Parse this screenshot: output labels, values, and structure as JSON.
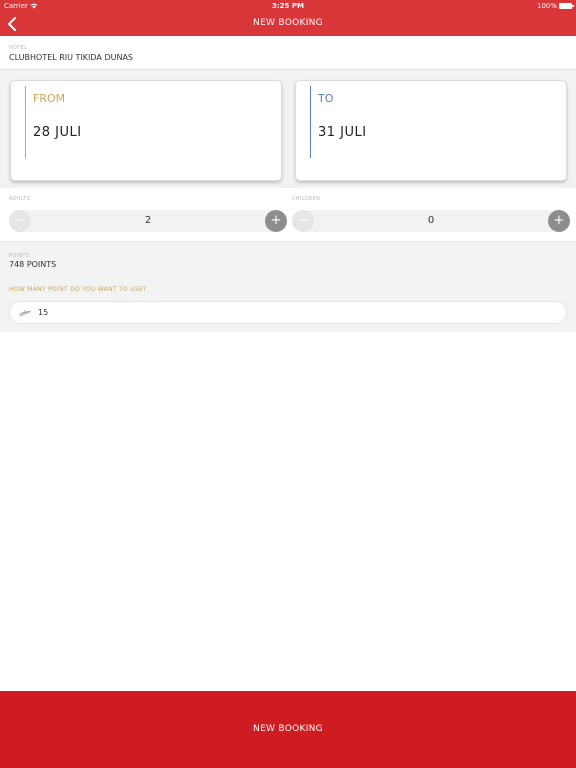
{
  "status_bar": {
    "carrier": "Carrier",
    "time": "3:25 PM",
    "battery": "100%"
  },
  "header": {
    "title": "NEW BOOKING"
  },
  "hotel": {
    "label": "HOTEL",
    "value": "CLUBHOTEL RIU TIKIDA DUNAS"
  },
  "dates": {
    "from": {
      "label": "FROM",
      "value": "28 JULI"
    },
    "to": {
      "label": "TO",
      "value": "31 JULI"
    }
  },
  "guests": {
    "adults": {
      "label": "ADULTS",
      "value": "2",
      "minus": "−",
      "plus": "+"
    },
    "children": {
      "label": "CHILDREN",
      "value": "0",
      "minus": "−",
      "plus": "+"
    }
  },
  "points": {
    "label": "POINTS",
    "value": "748 POINTS",
    "question": "HOW MANY POINT DO YOU WANT TO USE?",
    "input_value": "15"
  },
  "footer": {
    "button_label": "NEW BOOKING"
  },
  "colors": {
    "header": "#d9363a",
    "footer": "#cf1c20",
    "from_accent": "#c9a55a",
    "to_accent": "#5b7fb6"
  },
  "icons": {
    "back": "chevron-left-icon",
    "points_input": "plane-icon",
    "wifi": "wifi-icon",
    "battery": "battery-icon"
  }
}
